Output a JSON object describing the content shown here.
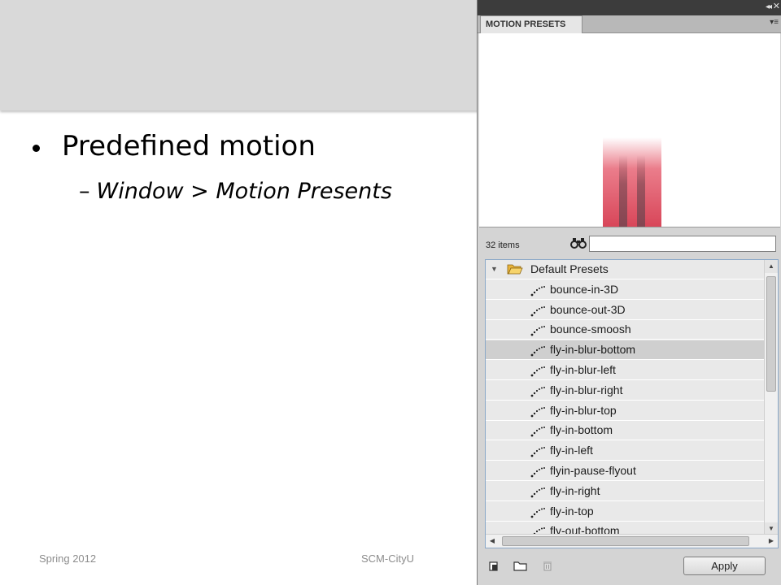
{
  "slide": {
    "bullet": "Predefined motion",
    "sub_bullet_dash": "–",
    "sub_bullet": "Window > Motion Presents",
    "footer_left": "Spring 2012",
    "footer_center": "SCM-CityU"
  },
  "panel": {
    "title": "MOTION PRESETS",
    "collapse_glyph": "◂◂",
    "close_glyph": "✕",
    "menu_glyph": "▾≡",
    "item_count": "32 items",
    "search_value": "",
    "folder": "Default Presets",
    "presets": [
      "bounce-in-3D",
      "bounce-out-3D",
      "bounce-smoosh",
      "fly-in-blur-bottom",
      "fly-in-blur-left",
      "fly-in-blur-right",
      "fly-in-blur-top",
      "fly-in-bottom",
      "fly-in-left",
      "flyin-pause-flyout",
      "fly-in-right",
      "fly-in-top",
      "fly-out-bottom"
    ],
    "selected_index": 3,
    "apply_label": "Apply"
  },
  "icons": {
    "search": "binoculars-icon",
    "folder": "folder-open-icon",
    "preset": "motion-path-icon"
  }
}
